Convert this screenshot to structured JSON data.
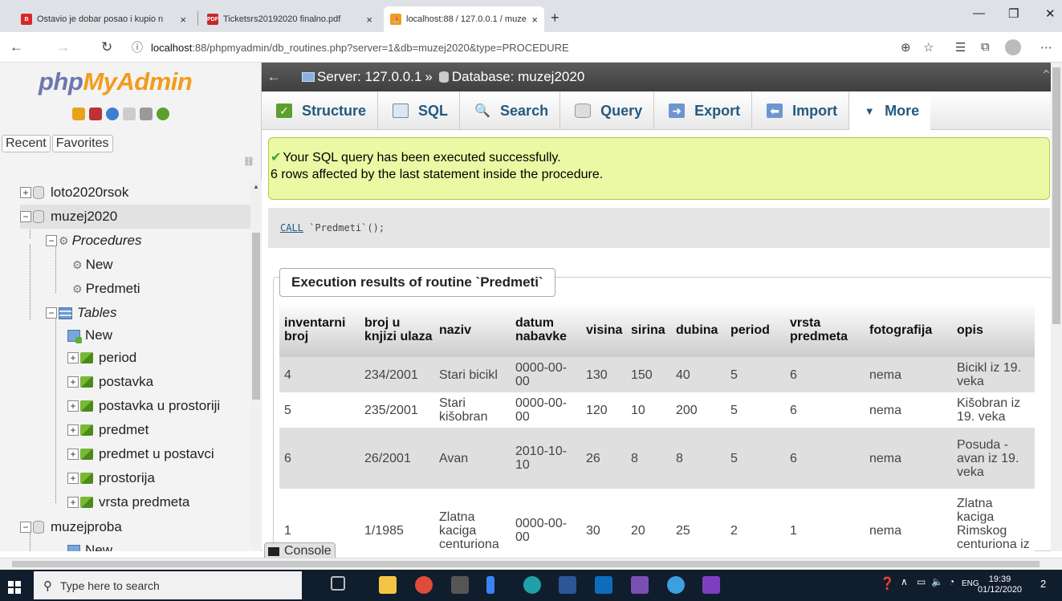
{
  "browser": {
    "tabs": [
      {
        "title": "Ostavio je dobar posao i kupio n",
        "icon": "news-icon",
        "close": "×"
      },
      {
        "title": "Ticketsrs20192020 finalno.pdf",
        "icon": "pdf-icon",
        "close": "×"
      },
      {
        "title": "localhost:88 / 127.0.0.1 / muzej2(",
        "icon": "phpmyadmin-icon",
        "close": "×"
      }
    ],
    "new_tab": "+",
    "url_domain": "localhost",
    "url_rest": ":88/phpmyadmin/db_routines.php?server=1&db=muzej2020&type=PROCEDURE"
  },
  "sidebar": {
    "logo_part1": "php",
    "logo_part2": "MyAdmin",
    "recent": "Recent",
    "favorites": "Favorites",
    "tree": {
      "loto": "loto2020rsok",
      "muzej": "muzej2020",
      "procedures": "Procedures",
      "proc_new": "New",
      "proc_predmeti": "Predmeti",
      "tables": "Tables",
      "tables_new": "New",
      "t1": "period",
      "t2": "postavka",
      "t3": "postavka u prostoriji",
      "t4": "predmet",
      "t5": "predmet u postavci",
      "t6": "prostorija",
      "t7": "vrsta predmeta",
      "muzejproba": "muzejproba",
      "mp_new": "New"
    }
  },
  "breadcrumb": {
    "server": "Server: 127.0.0.1",
    "sep": "»",
    "database": "Database: muzej2020"
  },
  "menu": {
    "structure": "Structure",
    "sql": "SQL",
    "search": "Search",
    "query": "Query",
    "export": "Export",
    "import": "Import",
    "more": "More"
  },
  "message": {
    "line1": "Your SQL query has been executed successfully.",
    "line2": "6 rows affected by the last statement inside the procedure."
  },
  "sql": {
    "keyword": "CALL",
    "rest": " `Predmeti`();"
  },
  "results": {
    "legend": "Execution results of routine `Predmeti`",
    "columns": [
      "inventarni broj",
      "broj u knjizi ulaza",
      "naziv",
      "datum nabavke",
      "visina",
      "sirina",
      "dubina",
      "period",
      "vrsta predmeta",
      "fotografija",
      "opis"
    ],
    "rows": [
      [
        "4",
        "234/2001",
        "Stari bicikl",
        "0000-00-00",
        "130",
        "150",
        "40",
        "5",
        "6",
        "nema",
        "Bicikl iz 19. veka"
      ],
      [
        "5",
        "235/2001",
        "Stari kišobran",
        "0000-00-00",
        "120",
        "10",
        "200",
        "5",
        "6",
        "nema",
        "Kišobran iz 19. veka"
      ],
      [
        "6",
        "26/2001",
        "Avan",
        "2010-10-10",
        "26",
        "8",
        "8",
        "5",
        "6",
        "nema",
        "Posuda - avan iz 19. veka"
      ],
      [
        "1",
        "1/1985",
        "Zlatna kaciga centuriona",
        "0000-00-00",
        "30",
        "20",
        "25",
        "2",
        "1",
        "nema",
        "Zlatna kaciga Rimskog centuriona iz Viminacijuma"
      ]
    ]
  },
  "console": "Console",
  "taskbar": {
    "search_placeholder": "Type here to search",
    "lang": "ENG",
    "time": "19:39",
    "date": "01/12/2020",
    "notif": "2"
  }
}
